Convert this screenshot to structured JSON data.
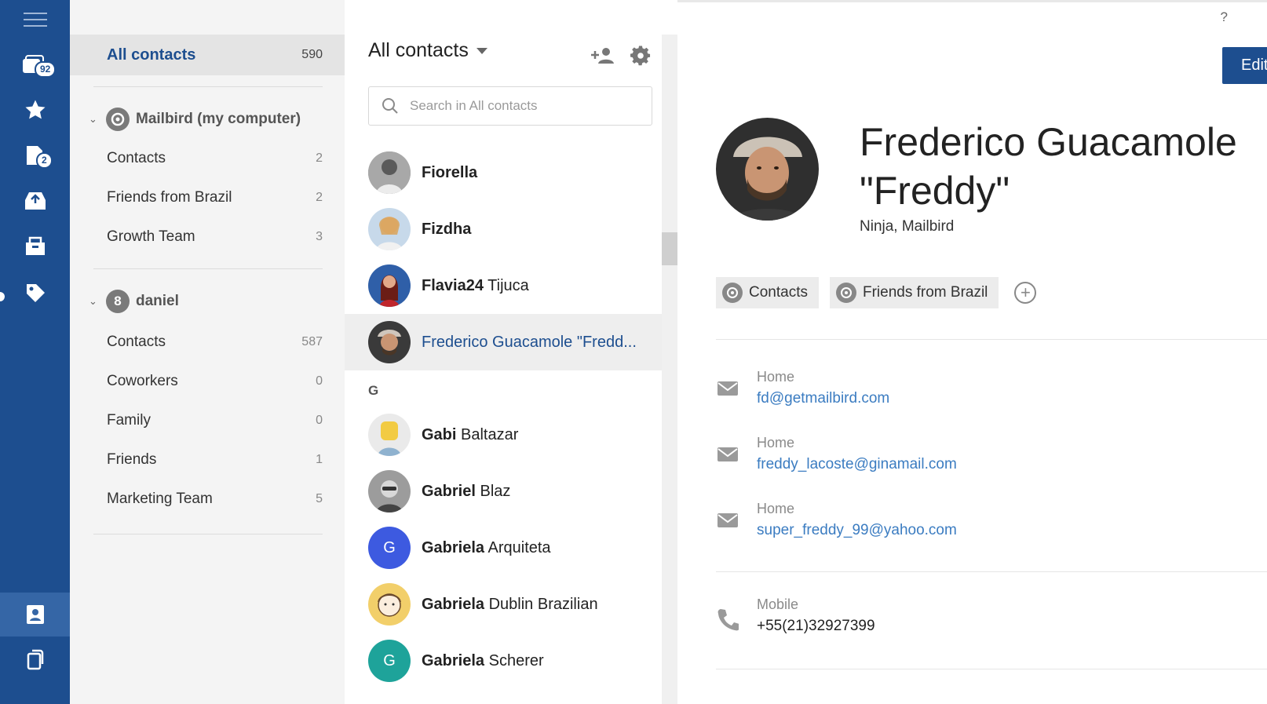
{
  "rail": {
    "unread_badge": "92",
    "drafts_badge": "2"
  },
  "groups": {
    "all": {
      "label": "All contacts",
      "count": "590"
    },
    "accounts": [
      {
        "name": "Mailbird (my computer)",
        "icon": "mailbird-logo",
        "groups": [
          {
            "label": "Contacts",
            "count": "2"
          },
          {
            "label": "Friends from Brazil",
            "count": "2"
          },
          {
            "label": "Growth Team",
            "count": "3"
          }
        ]
      },
      {
        "name": "daniel",
        "icon": "google-logo",
        "initial": "8",
        "groups": [
          {
            "label": "Contacts",
            "count": "587"
          },
          {
            "label": "Coworkers",
            "count": "0"
          },
          {
            "label": "Family",
            "count": "0"
          },
          {
            "label": "Friends",
            "count": "1"
          },
          {
            "label": "Marketing Team",
            "count": "5"
          }
        ]
      }
    ]
  },
  "list": {
    "title": "All contacts",
    "search_placeholder": "Search in All contacts",
    "section_letter": "G",
    "contacts": [
      {
        "first": "Fiorella",
        "last": "",
        "avatar_color": "#9a9a9a"
      },
      {
        "first": "Fizdha",
        "last": "",
        "avatar_color": "#d9a35a"
      },
      {
        "first": "Flavia24",
        "last": "Tijuca",
        "avatar_color": "#2f5fa8"
      },
      {
        "first": "Frederico Guacamole \"Fredd...",
        "last": "",
        "avatar_color": "#8a6e58",
        "selected": true
      },
      {
        "first": "Gabi",
        "last": "Baltazar",
        "avatar_color": "#e8c24a"
      },
      {
        "first": "Gabriel",
        "last": "Blaz",
        "avatar_color": "#8e8e8e"
      },
      {
        "first": "Gabriela",
        "last": "Arquiteta",
        "avatar_color": "#3d5ae0",
        "initial": "G"
      },
      {
        "first": "Gabriela",
        "last": "Dublin Brazilian",
        "avatar_color": "#f2cf6a"
      },
      {
        "first": "Gabriela",
        "last": "Scherer",
        "avatar_color": "#1ea39a",
        "initial": "G"
      }
    ]
  },
  "detail": {
    "help": "?",
    "edit_label": "Edit",
    "name_line1": "Frederico Guacamole",
    "name_line2": "\"Freddy\"",
    "subtitle": "Ninja, Mailbird",
    "tags": [
      "Contacts",
      "Friends from Brazil"
    ],
    "emails": [
      {
        "label": "Home",
        "value": "fd@getmailbird.com"
      },
      {
        "label": "Home",
        "value": "freddy_lacoste@ginamail.com"
      },
      {
        "label": "Home",
        "value": "super_freddy_99@yahoo.com"
      }
    ],
    "phone": {
      "label": "Mobile",
      "value": "+55(21)32927399"
    }
  },
  "colors": {
    "rail": "#1d4e8f",
    "accent": "#1d4e8f",
    "link": "#3b7cc1"
  }
}
